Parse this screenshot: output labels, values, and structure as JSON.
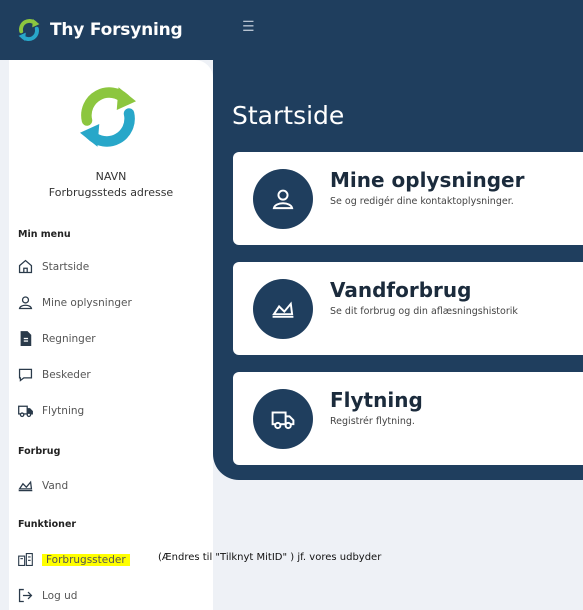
{
  "topbar": {
    "brand_name": "Thy Forsyning",
    "menu_icon": "hamburger-icon"
  },
  "sidebar": {
    "user_name": "NAVN",
    "address": "Forbrugssteds adresse",
    "sections": {
      "min_menu": "Min menu",
      "forbrug": "Forbrug",
      "funktioner": "Funktioner"
    },
    "items": [
      {
        "label": "Startside",
        "icon": "home-icon"
      },
      {
        "label": "Mine oplysninger",
        "icon": "user-icon"
      },
      {
        "label": "Regninger",
        "icon": "document-icon"
      },
      {
        "label": "Beskeder",
        "icon": "message-icon"
      },
      {
        "label": "Flytning",
        "icon": "truck-icon"
      },
      {
        "label": "Vand",
        "icon": "chart-icon"
      },
      {
        "label": "Forbrugssteder",
        "icon": "buildings-icon"
      },
      {
        "label": "Log ud",
        "icon": "logout-icon"
      }
    ],
    "annotation": "(Ændres til  \"Tilknyt MitID\" ) jf. vores udbyder"
  },
  "main": {
    "title": "Startside",
    "cards": [
      {
        "title": "Mine oplysninger",
        "subtitle": "Se og redigér dine kontaktoplysninger.",
        "icon": "user-icon"
      },
      {
        "title": "Vandforbrug",
        "subtitle": "Se dit forbrug og din aflæsningshistorik",
        "icon": "chart-icon"
      },
      {
        "title": "Flytning",
        "subtitle": "Registrér flytning.",
        "icon": "truck-icon"
      }
    ]
  },
  "colors": {
    "navy": "#1f3e5e",
    "logo_green": "#8cc63f",
    "logo_teal": "#28a7c9",
    "highlight": "#ffff00"
  }
}
